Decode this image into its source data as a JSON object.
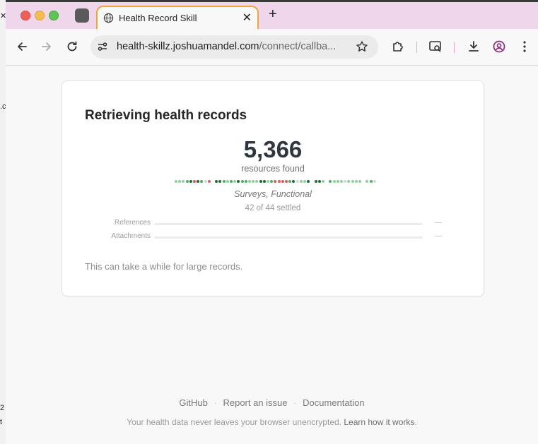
{
  "browser": {
    "tab_title": "Health Record Skill",
    "new_tab_symbol": "+",
    "close_symbol": "✕",
    "url_host": "health-skillz.joshuamandel.com",
    "url_rest": "/connect/callba..."
  },
  "card": {
    "title": "Retrieving health records",
    "count": "5,366",
    "count_label": "resources found",
    "current_type": "Surveys, Functional",
    "settled": "42 of 44 settled",
    "progress": [
      {
        "label": "References",
        "value": "—"
      },
      {
        "label": "Attachments",
        "value": "—"
      }
    ],
    "hint": "This can take a while for large records."
  },
  "status_dots": [
    "lg",
    "lg",
    "lg",
    "mg",
    "dg",
    "rd",
    "dg",
    "mg",
    "gy",
    "rd",
    "sp",
    "dg",
    "dg",
    "mg",
    "lg",
    "mg",
    "lg",
    "dg",
    "mg",
    "mg",
    "lg",
    "lg",
    "lg",
    "dg",
    "dg",
    "lg",
    "mg",
    "rd",
    "rd",
    "rd",
    "rd",
    "mg",
    "dg",
    "gy",
    "lg",
    "lg",
    "dg",
    "sp",
    "dg",
    "dg",
    "lg",
    "sp",
    "mg",
    "lg",
    "lg",
    "lg",
    "gy",
    "lg",
    "lg",
    "lg",
    "lg",
    "sp",
    "lg",
    "mg",
    "gy"
  ],
  "dot_colors": {
    "lg": "#8fd19e",
    "mg": "#4caf68",
    "dg": "#1f6b34",
    "rd": "#e25b56",
    "gy": "#d6d6d6",
    "sp": "transparent"
  },
  "footer": {
    "links": [
      "GitHub",
      "Report an issue",
      "Documentation"
    ],
    "separator": "·",
    "note_text": "Your health data never leaves your browser unencrypted.",
    "note_link": "Learn how it works",
    "note_end": "."
  },
  "colors": {
    "tab_bar": "#f0d6ea",
    "active_tab_border": "#f0a43a"
  }
}
